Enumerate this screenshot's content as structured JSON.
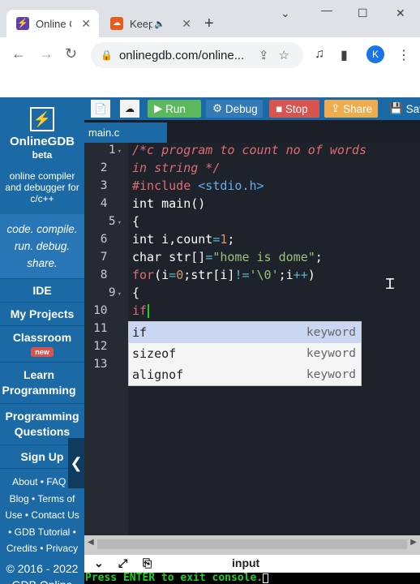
{
  "browser": {
    "tabs": [
      {
        "title": "Online C",
        "favicon": "onlinegdb-icon"
      },
      {
        "title": "Keep",
        "favicon": "keep-icon",
        "audio": true
      }
    ],
    "url": "onlinegdb.com/online...",
    "profile_initial": "K"
  },
  "sidebar": {
    "brand": "OnlineGDB",
    "beta": "beta",
    "tagline": "online compiler and debugger for c/c++",
    "slogan": [
      "code. compile.",
      "run. debug.",
      "share."
    ],
    "nav": [
      {
        "label": "IDE"
      },
      {
        "label": "My Projects"
      },
      {
        "label": "Classroom",
        "badge": "new"
      },
      {
        "label": "Learn Programming"
      },
      {
        "label": "Programming Questions"
      },
      {
        "label": "Sign Up"
      }
    ],
    "footer_links": [
      "About",
      "FAQ",
      "Blog",
      "Terms of Use",
      "Contact Us",
      "GDB Tutorial",
      "Credits",
      "Privacy"
    ],
    "copyright": [
      "© 2016 - 2022",
      "GDB Online"
    ]
  },
  "toolbar": {
    "run": "Run",
    "debug": "Debug",
    "stop": "Stop",
    "share": "Share",
    "save": "Save",
    "colors": {
      "bar": "#1b6aa5",
      "run": "#5cb85c",
      "debug": "#337ab7",
      "stop": "#d9534f",
      "share": "#f0ad4e",
      "save": "#1b6aa5"
    }
  },
  "editor": {
    "file_tab": "main.c",
    "line_numbers": [
      "1",
      "2",
      "3",
      "4",
      "5",
      "6",
      "7",
      "8",
      "9",
      "10",
      "11",
      "12",
      "13"
    ],
    "code_lines": [
      "/*c program to count no of words",
      "in string */",
      "#include <stdio.h>",
      "int main()",
      "{",
      "int i,count=1;",
      "char str[]=\"home is dome\";",
      "for(i=0;str[i]!='\\0';i++)",
      "{",
      "if"
    ],
    "autocomplete": [
      {
        "word": "if",
        "kind": "keyword",
        "selected": true
      },
      {
        "word": "sizeof",
        "kind": "keyword",
        "selected": false
      },
      {
        "word": "alignof",
        "kind": "keyword",
        "selected": false
      }
    ]
  },
  "console": {
    "input_label": "input",
    "output": "Press ENTER to exit console."
  }
}
